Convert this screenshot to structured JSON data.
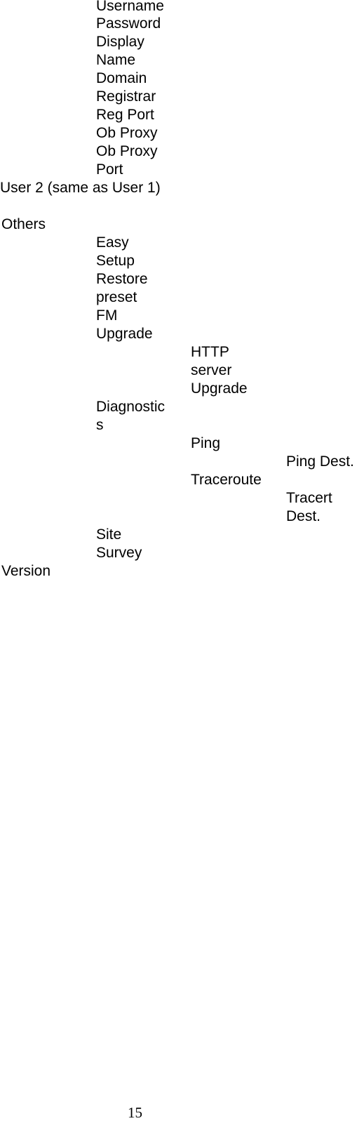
{
  "user1_fields": [
    "Username",
    "Password",
    "Display",
    "Name",
    "Domain",
    "Registrar",
    "Reg Port",
    "Ob Proxy",
    "Ob Proxy",
    "Port"
  ],
  "user2": "User 2 (same as User 1)",
  "others": {
    "heading": "Others",
    "easy_setup": [
      "Easy",
      "Setup"
    ],
    "restore_preset": [
      "Restore",
      "preset"
    ],
    "fm_upgrade": [
      "FM",
      "Upgrade"
    ],
    "http_server_upgrade": [
      "HTTP",
      "server",
      "Upgrade"
    ],
    "diagnostics": [
      "Diagnostic",
      "s"
    ],
    "ping": "Ping",
    "ping_dest": "Ping Dest.",
    "traceroute": "Traceroute",
    "tracert_dest": [
      "Tracert",
      "Dest."
    ],
    "site_survey": [
      "Site",
      "Survey"
    ]
  },
  "version": "Version",
  "page_number": "15"
}
